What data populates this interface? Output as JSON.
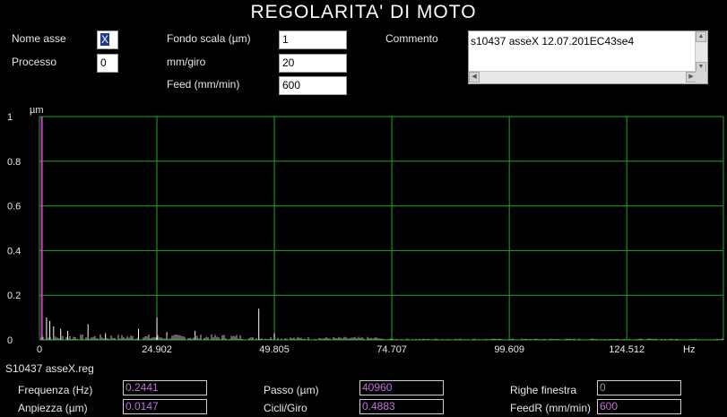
{
  "title": "REGOLARITA' DI MOTO",
  "fields": {
    "nome_asse_label": "Nome asse",
    "nome_asse_value": "X",
    "processo_label": "Processo",
    "processo_value": "0",
    "fondo_scala_label": "Fondo scala (µm)",
    "fondo_scala_value": "1",
    "mm_giro_label": "mm/giro",
    "mm_giro_value": "20",
    "feed_label": "Feed (mm/min)",
    "feed_value": "600",
    "commento_label": "Commento",
    "commento_value": "s10437 asseX 12.07.201EC43se4"
  },
  "chart_data": {
    "type": "bar",
    "ylabel": "µm",
    "xlabel": "Hz",
    "ylim": [
      0,
      1
    ],
    "xlim": [
      0,
      145
    ],
    "yticks": [
      "0",
      "0.2",
      "0.4",
      "0.6",
      "0.8",
      "1"
    ],
    "xticks": [
      "0",
      "24.902",
      "49.805",
      "74.707",
      "99.609",
      "124.512"
    ],
    "grid": true,
    "marker_x": 0.5,
    "marker_color": "#d040d0",
    "line_color": "#ffffff",
    "grid_color": "#1ea81e",
    "peaks": [
      {
        "x": 1.5,
        "y": 0.1
      },
      {
        "x": 2.2,
        "y": 0.085
      },
      {
        "x": 3.0,
        "y": 0.06
      },
      {
        "x": 4.5,
        "y": 0.05
      },
      {
        "x": 6.0,
        "y": 0.04
      },
      {
        "x": 10.3,
        "y": 0.07
      },
      {
        "x": 14.0,
        "y": 0.03
      },
      {
        "x": 21.0,
        "y": 0.05
      },
      {
        "x": 24.9,
        "y": 0.1
      },
      {
        "x": 27.0,
        "y": 0.035
      },
      {
        "x": 33.0,
        "y": 0.04
      },
      {
        "x": 46.5,
        "y": 0.14
      },
      {
        "x": 49.8,
        "y": 0.03
      }
    ]
  },
  "file_name": "S10437 asseX.reg",
  "readouts": {
    "frequenza_label": "Frequenza (Hz)",
    "frequenza_value": "0.2441",
    "ampiezza_label": "Anpiezza (µm)",
    "ampiezza_value": "0.0147",
    "passo_label": "Passo (µm)",
    "passo_value": "40960",
    "cicli_label": "Cicli/Giro",
    "cicli_value": "0.4883",
    "righe_label": "Righe finestra",
    "righe_value": "0",
    "feedr_label": "FeedR (mm/min)",
    "feedr_value": "600"
  }
}
